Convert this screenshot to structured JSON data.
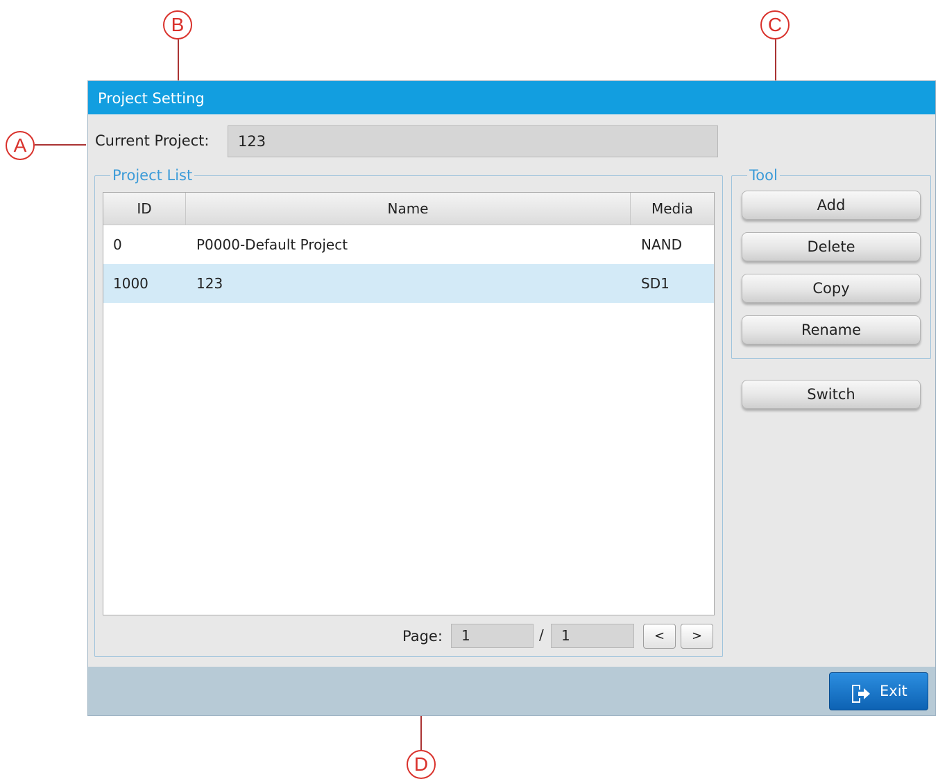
{
  "callouts": {
    "a": "A",
    "b": "B",
    "c": "C",
    "d": "D"
  },
  "window": {
    "title": "Project Setting",
    "current_project_label": "Current Project:",
    "current_project_value": "123"
  },
  "project_list": {
    "legend": "Project List",
    "columns": {
      "id": "ID",
      "name": "Name",
      "media": "Media"
    },
    "rows": [
      {
        "id": "0",
        "name": "P0000-Default Project",
        "media": "NAND"
      },
      {
        "id": "1000",
        "name": "123",
        "media": "SD1"
      }
    ],
    "selected_row": 1
  },
  "pager": {
    "label": "Page:",
    "current": "1",
    "separator": "/",
    "total": "1",
    "prev": "<",
    "next": ">"
  },
  "tool": {
    "legend": "Tool",
    "add": "Add",
    "delete": "Delete",
    "copy": "Copy",
    "rename": "Rename"
  },
  "switch_label": "Switch",
  "exit_label": "Exit",
  "colors": {
    "titlebar": "#129ee0",
    "selected_row": "#d3eaf7",
    "callout": "#d9312b",
    "exit_button": "#1a78cc"
  }
}
